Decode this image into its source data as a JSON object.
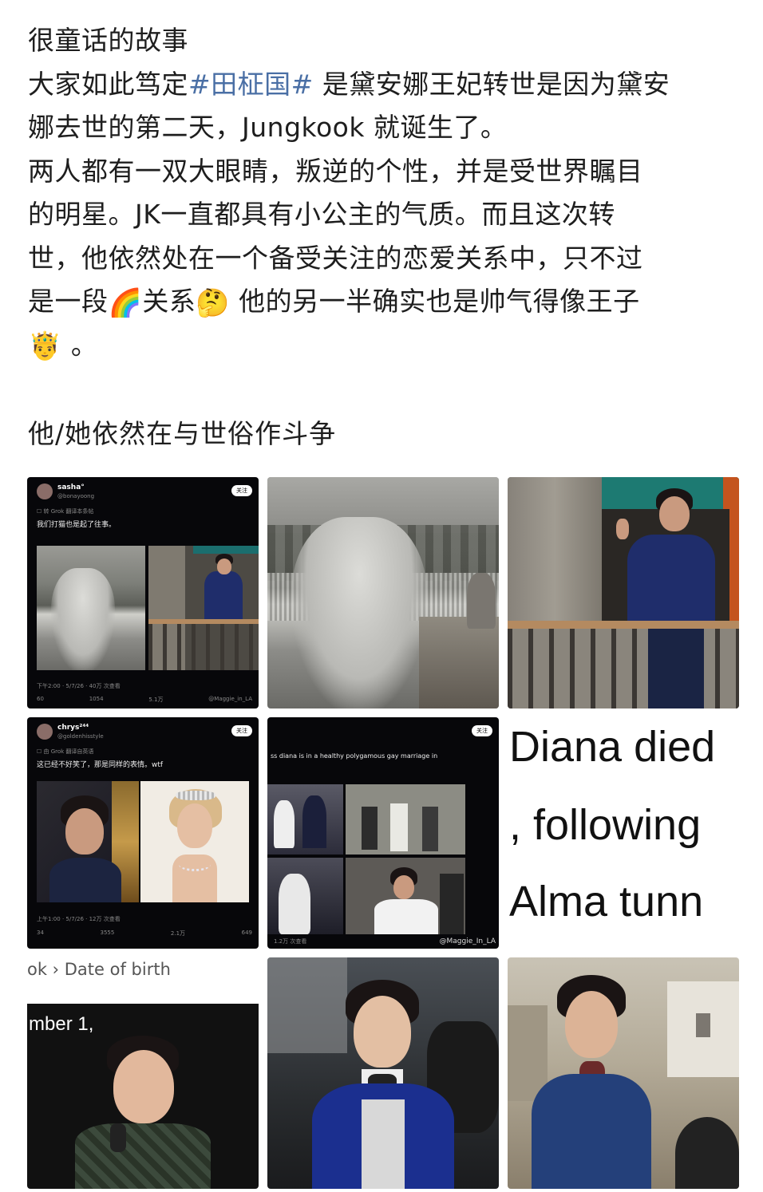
{
  "post": {
    "lines": [
      [
        "很童话的故事"
      ],
      [
        "大家如此笃定",
        "#田柾国#",
        " 是黛安娜王妃转世是因为黛安"
      ],
      [
        "娜去世的第二天，Jungkook 就诞生了。"
      ],
      [
        "两人都有一双大眼睛，叛逆的个性，并是受世界瞩目"
      ],
      [
        "的明星。JK一直都具有小公主的气质。而且这次转"
      ],
      [
        "世，他依然处在一个备受关注的恋爱关系中，只不过"
      ],
      [
        "是一段",
        "🌈",
        "关系",
        "🤔",
        " 他的另一半确实也是帅气得像王子"
      ],
      [
        "🤴",
        " 。"
      ]
    ],
    "subtitle": "他/她依然在与世俗作斗争"
  },
  "images": {
    "tweet1": {
      "name": "sasha°",
      "handle": "@bonayoong",
      "follow": "关注",
      "meta": "☐ 转 Grok 翻译本条帖",
      "text": "我们打猫也是起了往事。",
      "stats_time": "下午2:00 · 5/7/26 · 40万 次查看",
      "likes": "5.1万",
      "reposts": "1054",
      "replies": "60",
      "watermark": "@Maggie_in_LA"
    },
    "tweet2": {
      "name": "chrys²⁴⁴",
      "handle": "@goldenhisstyle",
      "follow": "关注",
      "meta": "☐ 由 Grok 翻译自英语",
      "text": "这已经不好笑了，那是同样的表情。wtf",
      "stats_time": "上午1:00 · 5/7/26 · 12万 次查看",
      "replies": "34",
      "reposts": "3555",
      "likes": "2.1万",
      "bookmarks": "649"
    },
    "tweet3": {
      "follow": "关注",
      "text": "ss diana is in a healthy polygamous gay marriage in",
      "views": "1.2万 次查看",
      "watermark": "@Maggie_In_LA"
    },
    "text_cell": {
      "line1": "Diana died",
      "line2": ", following",
      "line3": "Alma tunn"
    },
    "dob_cell": {
      "label": "ok › Date of birth",
      "partial": "mber 1,"
    }
  }
}
